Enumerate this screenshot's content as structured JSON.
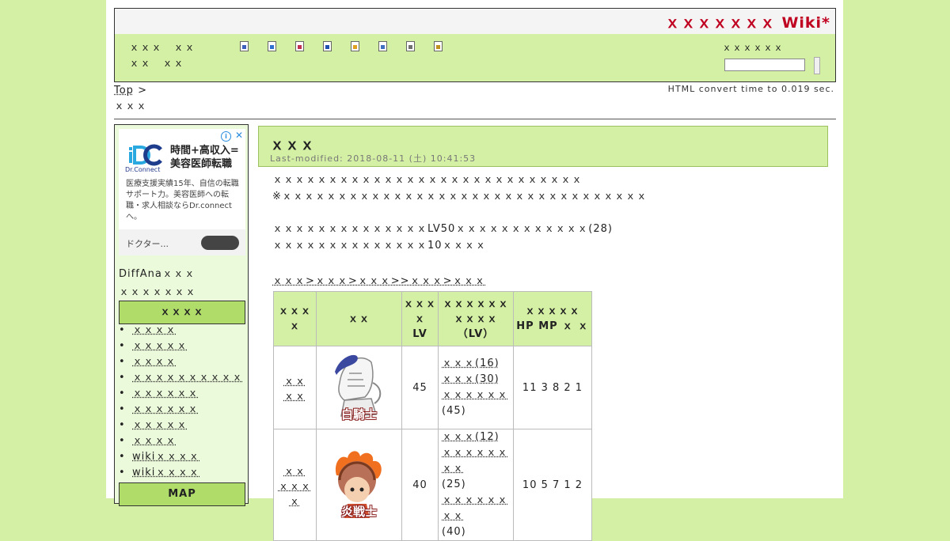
{
  "header": {
    "title": "ｘｘｘｘｘｘｘ Wiki*"
  },
  "nav": {
    "links": [
      "ｘｘｘ",
      "ｘｘ",
      "ｘｘ",
      "ｘｘ"
    ],
    "search_label": "ｘｘｘｘｘｘ"
  },
  "toolbar": {
    "icons": [
      {
        "name": "new-page-icon",
        "color": "#4060c0"
      },
      {
        "name": "edit-page-icon",
        "color": "#3070d0"
      },
      {
        "name": "diff-icon",
        "color": "#c03050"
      },
      {
        "name": "backup-icon",
        "color": "#2050b0"
      },
      {
        "name": "lock-icon",
        "color": "#e0a020"
      },
      {
        "name": "copy-icon",
        "color": "#4070c0"
      },
      {
        "name": "list-icon",
        "color": "#707070"
      },
      {
        "name": "help-icon",
        "color": "#c09020"
      }
    ]
  },
  "breadcrumb": {
    "top": "Top",
    "sep": ">",
    "current": "ｘｘｘ"
  },
  "convert_time": "HTML convert time to 0.019 sec.",
  "sidebar": {
    "ad": {
      "headline_1": "時間+高収入=",
      "headline_2": "美容医師転職",
      "brand": "Dr.Connect",
      "body": "医療支援実績15年、自信の転職サポート力。美容医師への転職・求人相談ならDr.connectへ。",
      "advertiser": "ドクター..."
    },
    "link_1": "DiffAnaｘｘｘ",
    "link_2": "ｘｘｘｘｘｘｘ",
    "section_1": "ｘｘｘｘ",
    "menu": [
      "ｘｘｘｘ",
      "ｘｘｘｘｘ",
      "ｘｘｘｘ",
      "ｘｘｘｘｘｘｘｘｘｘ",
      "ｘｘｘｘｘｘ",
      "ｘｘｘｘｘｘ",
      "ｘｘｘｘｘ",
      "ｘｘｘｘ",
      "wikiｘｘｘｘ",
      "wikiｘｘｘｘ"
    ],
    "section_2": "MAP"
  },
  "content": {
    "title": "ｘｘｘ",
    "last_modified": "Last-modified: 2018-08-11 (土) 10:41:53",
    "para_1a": "ｘｘｘｘｘｘｘｘｘｘｘｘｘｘｘｘｘｘｘｘｘｘｘｘｘｘｘｘ",
    "para_1b": "※ｘｘｘｘｘｘｘｘｘｘｘｘｘｘｘｘｘｘｘｘｘｘｘｘｘｘｘｘｘｘｘｘｘ",
    "para_2a": "ｘｘｘｘｘｘｘｘｘｘｘｘｘｘLV50ｘｘｘｘｘｘｘｘｘｘｘｘ(28)",
    "para_2b": "ｘｘｘｘｘｘｘｘｘｘｘｘｘｘ10ｘｘｘｘ",
    "path": "ｘｘｘ>ｘｘｘ>ｘｘｘ>>ｘｘｘ>ｘｘｘ"
  },
  "table": {
    "headers": {
      "c1": "ｘｘｘｘ",
      "c2": "ｘｘ",
      "c3_line1": "ｘｘｘｘ",
      "c3_line2": "LV",
      "c4_line1": "ｘｘｘｘｘｘｘｘｘｘ",
      "c4_line2": "（LV）",
      "c5_line1": "ｘｘｘｘｘ",
      "c5_line2": "HP MP ｘ ｘ"
    },
    "rows": [
      {
        "name_1": "ｘｘ",
        "name_2": "ｘｘ",
        "image_label": "白騎士",
        "level": "45",
        "skills": [
          "ｘｘｘ(16)",
          "ｘｘｘ(30)",
          "ｘｘｘｘｘｘ",
          "(45)"
        ],
        "stats": "11 3 8 2 1"
      },
      {
        "name_1": "ｘｘ",
        "name_2": "ｘｘｘｘ",
        "image_label": "炎戦士",
        "level": "40",
        "skills": [
          "ｘｘｘ(12)",
          "ｘｘｘｘｘｘｘｘ",
          "(25)",
          "ｘｘｘｘｘｘｘｘ",
          "(40)"
        ],
        "stats": "10 5 7 1 2"
      }
    ]
  }
}
